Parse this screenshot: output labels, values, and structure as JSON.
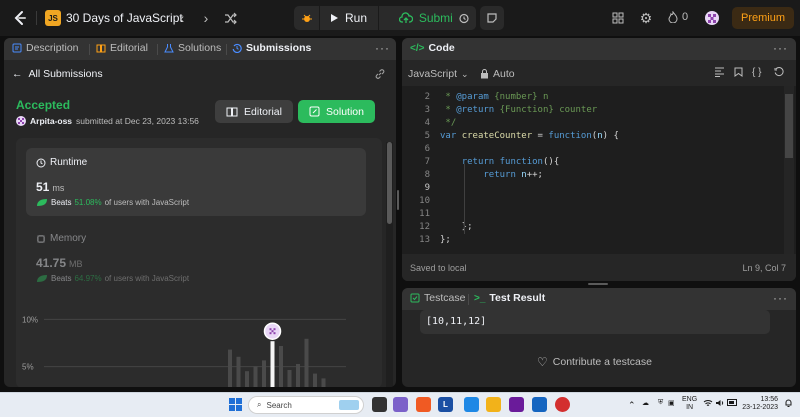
{
  "topnav": {
    "list_badge": "JS",
    "list_title": "30 Days of JavaScript",
    "run_label": "Run",
    "submit_label": "Submit",
    "streak_count": "0",
    "premium_label": "Premium"
  },
  "left_tabs": [
    {
      "label": "Description",
      "icon": "description-icon"
    },
    {
      "label": "Editorial",
      "icon": "book-icon"
    },
    {
      "label": "Solutions",
      "icon": "flask-icon"
    },
    {
      "label": "Submissions",
      "icon": "history-icon",
      "active": true
    }
  ],
  "submission": {
    "back_label": "All Submissions",
    "status": "Accepted",
    "author": "Arpita-oss",
    "submitted_text": "submitted at Dec 23, 2023 13:56",
    "editorial_btn": "Editorial",
    "solution_btn": "Solution",
    "runtime": {
      "label": "Runtime",
      "value": "51",
      "unit": "ms",
      "beats_prefix": "Beats",
      "beats_pct": "51.08%",
      "beats_suffix": "of users with JavaScript"
    },
    "memory": {
      "label": "Memory",
      "value": "41.75",
      "unit": "MB",
      "beats_prefix": "Beats",
      "beats_pct": "64.97%",
      "beats_suffix": "of users with JavaScript"
    }
  },
  "chart_data": {
    "type": "bar",
    "ytick_labels": [
      "10%",
      "5%"
    ],
    "yticks": [
      10,
      5
    ],
    "ylim": [
      4,
      11
    ],
    "grid": true,
    "values": [
      3.2,
      2.6,
      1.4,
      1.8,
      2.3,
      3.9,
      3.5,
      1.5,
      2.0,
      4.1,
      1.2,
      0.8
    ],
    "highlight_index": 5,
    "highlight_value": 3.5
  },
  "code_panel": {
    "title": "Code",
    "language": "JavaScript",
    "mode": "Auto",
    "line_numbers": [
      "2",
      "3",
      "4",
      "5",
      "6",
      "7",
      "8",
      "9",
      "10",
      "11",
      "12",
      "13"
    ],
    "current_line": "9",
    "lines": [
      [
        {
          "t": " * ",
          "c": "cmt"
        },
        {
          "t": "@param",
          "c": "cmt-tag"
        },
        {
          "t": " {number} n",
          "c": "cmt"
        }
      ],
      [
        {
          "t": " * ",
          "c": "cmt"
        },
        {
          "t": "@return",
          "c": "cmt-tag"
        },
        {
          "t": " {Function} counter",
          "c": "cmt"
        }
      ],
      [
        {
          "t": " */",
          "c": "cmt"
        }
      ],
      [
        {
          "t": "var ",
          "c": "kw"
        },
        {
          "t": "createCounter",
          "c": "fn"
        },
        {
          "t": " = ",
          "c": ""
        },
        {
          "t": "function",
          "c": "kw"
        },
        {
          "t": "(",
          "c": ""
        },
        {
          "t": "n",
          "c": "var"
        },
        {
          "t": ") {",
          "c": ""
        }
      ],
      [
        {
          "t": "",
          "c": ""
        }
      ],
      [
        {
          "t": "    ",
          "c": ""
        },
        {
          "t": "return ",
          "c": "kw"
        },
        {
          "t": "function",
          "c": "kw"
        },
        {
          "t": "(){",
          "c": ""
        }
      ],
      [
        {
          "t": "        ",
          "c": ""
        },
        {
          "t": "return ",
          "c": "kw"
        },
        {
          "t": "n",
          "c": "var"
        },
        {
          "t": "++;",
          "c": ""
        }
      ],
      [
        {
          "t": "",
          "c": ""
        }
      ],
      [
        {
          "t": "",
          "c": ""
        }
      ],
      [
        {
          "t": "",
          "c": ""
        }
      ],
      [
        {
          "t": "    };",
          "c": ""
        }
      ],
      [
        {
          "t": "};",
          "c": ""
        }
      ]
    ],
    "saved_text": "Saved to local",
    "cursor_pos": "Ln 9, Col 7"
  },
  "test_panel": {
    "tab_testcase": "Testcase",
    "tab_result": "Test Result",
    "output": "[10,11,12]",
    "contribute": "Contribute a testcase"
  },
  "taskbar": {
    "search_placeholder": "Search",
    "lang": "ENG",
    "region": "IN",
    "time": "13:56",
    "date": "23-12-2023"
  },
  "colors": {
    "accent_green": "#2cbb5d",
    "brand_orange": "#ffa116",
    "panel": "#262626"
  }
}
